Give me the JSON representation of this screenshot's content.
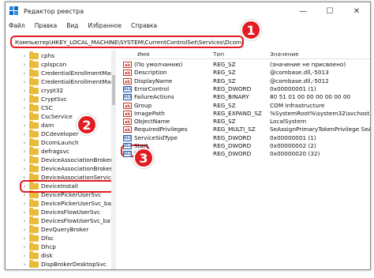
{
  "window": {
    "title": "Редактор реестра"
  },
  "menu": [
    "Файл",
    "Правка",
    "Вид",
    "Избранное",
    "Справка"
  ],
  "address": "Компьютер\\HKEY_LOCAL_MACHINE\\SYSTEM\\CurrentControlSet\\Services\\DcomLaunch",
  "tree": {
    "items": [
      "cphs",
      "cplspcon",
      "CredentialEnrollmentMana",
      "CredentialEnrollmentMana",
      "crypt32",
      "CryptSvc",
      "CSC",
      "CscService",
      "dam",
      "DCdeveloper",
      "DcomLaunch",
      "defragsvc",
      "DeviceAssociationBrokerSv",
      "DeviceAssociationBrokerSv",
      "DeviceAssociationService",
      "DeviceInstall",
      "DevicePickerUserSvc",
      "DevicePickerUserSvc_ba761",
      "DevicesFlowUserSvc",
      "DevicesFlowUserSvc_ba761",
      "DevQueryBroker",
      "Dfsc",
      "Dhcp",
      "disk",
      "DispBrokerDesktopSvc"
    ]
  },
  "values": {
    "headers": {
      "name": "Имя",
      "type": "Тип",
      "value": "Значение"
    },
    "rows": [
      {
        "icon": "ab",
        "name": "(По умолчанию)",
        "type": "REG_SZ",
        "value": "(значение не присвоено)"
      },
      {
        "icon": "ab",
        "name": "Description",
        "type": "REG_SZ",
        "value": "@combase.dll,-5013"
      },
      {
        "icon": "ab",
        "name": "DisplayName",
        "type": "REG_SZ",
        "value": "@combase.dll,-5012"
      },
      {
        "icon": "bin",
        "name": "ErrorControl",
        "type": "REG_DWORD",
        "value": "0x00000001 (1)"
      },
      {
        "icon": "bin",
        "name": "FailureActions",
        "type": "REG_BINARY",
        "value": "80 51 01 00 00 00 00 00 00"
      },
      {
        "icon": "ab",
        "name": "Group",
        "type": "REG_SZ",
        "value": "COM Infrastructure"
      },
      {
        "icon": "ab",
        "name": "ImagePath",
        "type": "REG_EXPAND_SZ",
        "value": "%SystemRoot%\\system32\\svchost.exe"
      },
      {
        "icon": "ab",
        "name": "ObjectName",
        "type": "REG_SZ",
        "value": "LocalSystem"
      },
      {
        "icon": "ab",
        "name": "RequiredPrivileges",
        "type": "REG_MULTI_SZ",
        "value": "SeAssignPrimaryTokenPrivilege SeAudit"
      },
      {
        "icon": "bin",
        "name": "ServiceSidType",
        "type": "REG_DWORD",
        "value": "0x00000001 (1)"
      },
      {
        "icon": "bin",
        "name": "Start",
        "type": "REG_DWORD",
        "value": "0x00000002 (2)"
      },
      {
        "icon": "bin",
        "name": "Type",
        "type": "REG_DWORD",
        "value": "0x00000020 (32)"
      }
    ]
  },
  "icons": {
    "ab": "ab",
    "bin": "011"
  },
  "badges": [
    "1",
    "2",
    "3"
  ],
  "colors": {
    "highlight": "#e31b23",
    "folder": "#e8bb3a"
  }
}
